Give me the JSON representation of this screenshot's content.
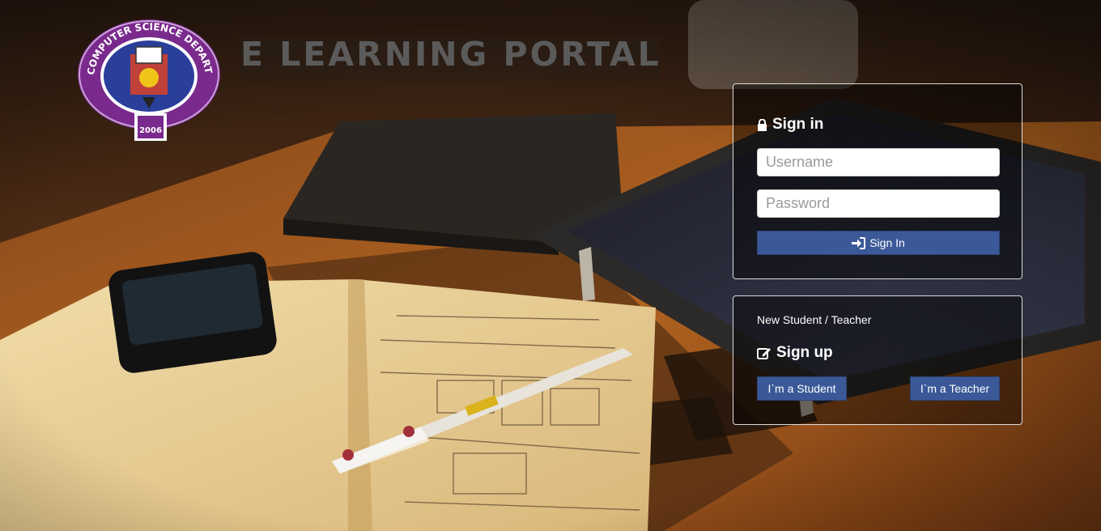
{
  "header": {
    "title": "E LEARNING PORTAL",
    "logo_icon": "computer-science-department-seal-icon",
    "logo_text_top": "COMPUTER SCIENCE DEPARTMENT",
    "logo_year": "2006"
  },
  "signin": {
    "heading": "Sign in",
    "heading_icon": "lock-icon",
    "username_placeholder": "Username",
    "username_value": "",
    "password_placeholder": "Password",
    "password_value": "",
    "button_label": "Sign In",
    "button_icon": "sign-in-icon"
  },
  "signup": {
    "intro": "New Student / Teacher",
    "heading": "Sign up",
    "heading_icon": "edit-icon",
    "student_button": "I`m a Student",
    "teacher_button": "I`m a Teacher"
  },
  "colors": {
    "button": "#3b5998",
    "panel_border": "#ffffff",
    "title_text": "#5b5b5b"
  }
}
